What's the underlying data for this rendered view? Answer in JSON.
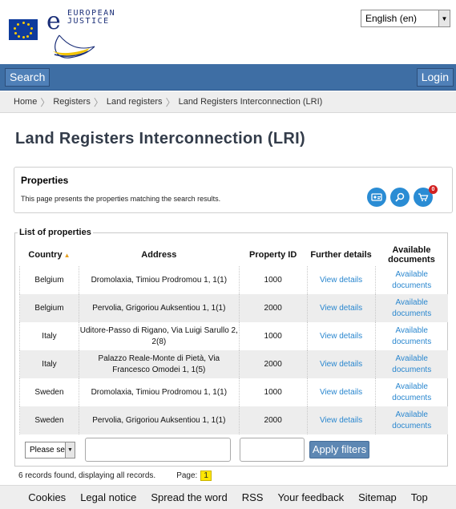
{
  "header": {
    "logo_text_line1": "EUROPEAN",
    "logo_text_line2": "JUSTICE",
    "logo_mark_letter": "e",
    "language": "English (en)"
  },
  "topbar": {
    "search_label": "Search",
    "login_label": "Login"
  },
  "breadcrumb": [
    "Home",
    "Registers",
    "Land registers",
    "Land Registers Interconnection (LRI)"
  ],
  "page_title": "Land Registers Interconnection (LRI)",
  "properties_panel": {
    "title": "Properties",
    "description": "This page presents the properties matching the search results.",
    "icons": [
      "id-card-icon",
      "search-icon",
      "cart-icon"
    ],
    "cart_count": "0"
  },
  "list": {
    "legend": "List of properties",
    "columns": [
      "Country",
      "Address",
      "Property ID",
      "Further details",
      "Available documents"
    ],
    "rows": [
      {
        "country": "Belgium",
        "address": "Dromolaxia, Timiou Prodromou 1, 1(1)",
        "property_id": "1000",
        "details": "View details",
        "documents": "Available documents"
      },
      {
        "country": "Belgium",
        "address": "Pervolia, Grigoriou Auksentiou 1, 1(1)",
        "property_id": "2000",
        "details": "View details",
        "documents": "Available documents"
      },
      {
        "country": "Italy",
        "address": "Uditore-Passo di Rigano, Via Luigi Sarullo 2, 2(8)",
        "property_id": "1000",
        "details": "View details",
        "documents": "Available documents"
      },
      {
        "country": "Italy",
        "address": "Palazzo Reale-Monte di Pietà, Via Francesco Omodei 1, 1(5)",
        "property_id": "2000",
        "details": "View details",
        "documents": "Available documents"
      },
      {
        "country": "Sweden",
        "address": "Dromolaxia, Timiou Prodromou 1, 1(1)",
        "property_id": "1000",
        "details": "View details",
        "documents": "Available documents"
      },
      {
        "country": "Sweden",
        "address": "Pervolia, Grigoriou Auksentiou 1, 1(1)",
        "property_id": "2000",
        "details": "View details",
        "documents": "Available documents"
      }
    ]
  },
  "filters": {
    "country_select": "Please se",
    "address_value": "",
    "property_id_value": "",
    "apply_label": "Apply filters"
  },
  "records": {
    "summary": "6 records found, displaying all records.",
    "page_label": "Page:",
    "page_number": "1"
  },
  "footer": [
    "Cookies",
    "Legal notice",
    "Spread the word",
    "RSS",
    "Your feedback",
    "Sitemap",
    "Top"
  ],
  "colors": {
    "topbar": "#3e6ea4",
    "link": "#2a87cf",
    "icon_blue": "#2a8cd4",
    "page_highlight": "#ffe600"
  }
}
